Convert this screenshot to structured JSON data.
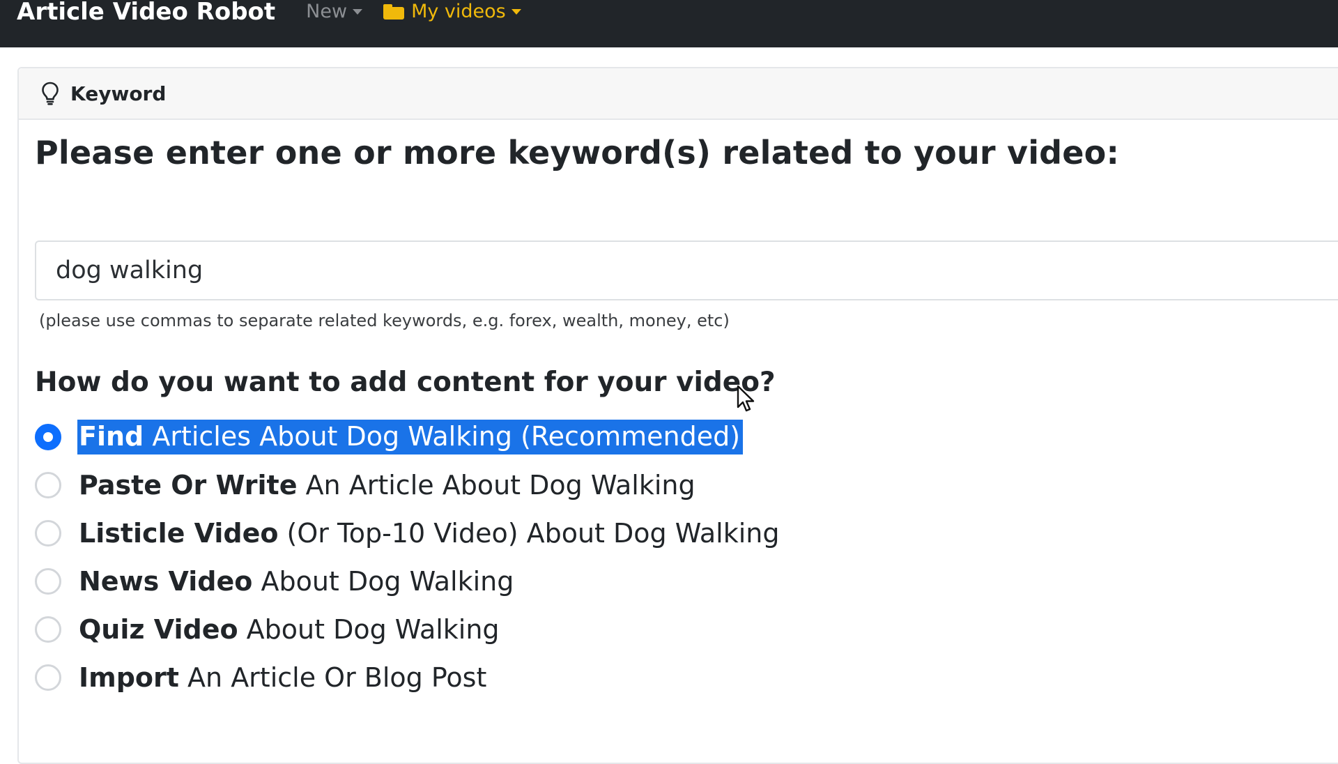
{
  "navbar": {
    "brand": "Article Video Robot",
    "new_label": "New",
    "my_videos_label": "My videos",
    "my_videos_color": "#f0b90b"
  },
  "card": {
    "title": "Keyword",
    "question": "Please enter one or more keyword(s) related to your video:",
    "keyword_value": "dog walking",
    "help_text": "(please use commas to separate related keywords, e.g. forex, wealth, money, etc)",
    "content_question": "How do you want to add content for your video?",
    "options": [
      {
        "bold": "Find",
        "rest": " Articles About Dog Walking (Recommended)",
        "selected": true
      },
      {
        "bold": "Paste Or Write",
        "rest": " An Article About Dog Walking",
        "selected": false
      },
      {
        "bold": "Listicle Video",
        "rest": " (Or Top-10 Video) About Dog Walking",
        "selected": false
      },
      {
        "bold": "News Video",
        "rest": " About Dog Walking",
        "selected": false
      },
      {
        "bold": "Quiz Video",
        "rest": " About Dog Walking",
        "selected": false
      },
      {
        "bold": "Import",
        "rest": " An Article Or Blog Post",
        "selected": false
      }
    ]
  },
  "colors": {
    "accent": "#0d6efd",
    "selection_highlight": "#1a73e8",
    "navbar_bg": "#212529"
  },
  "icons": {
    "folder": "folder-icon",
    "keyword": "lightbulb-icon",
    "cursor": "mouse-pointer-icon"
  }
}
